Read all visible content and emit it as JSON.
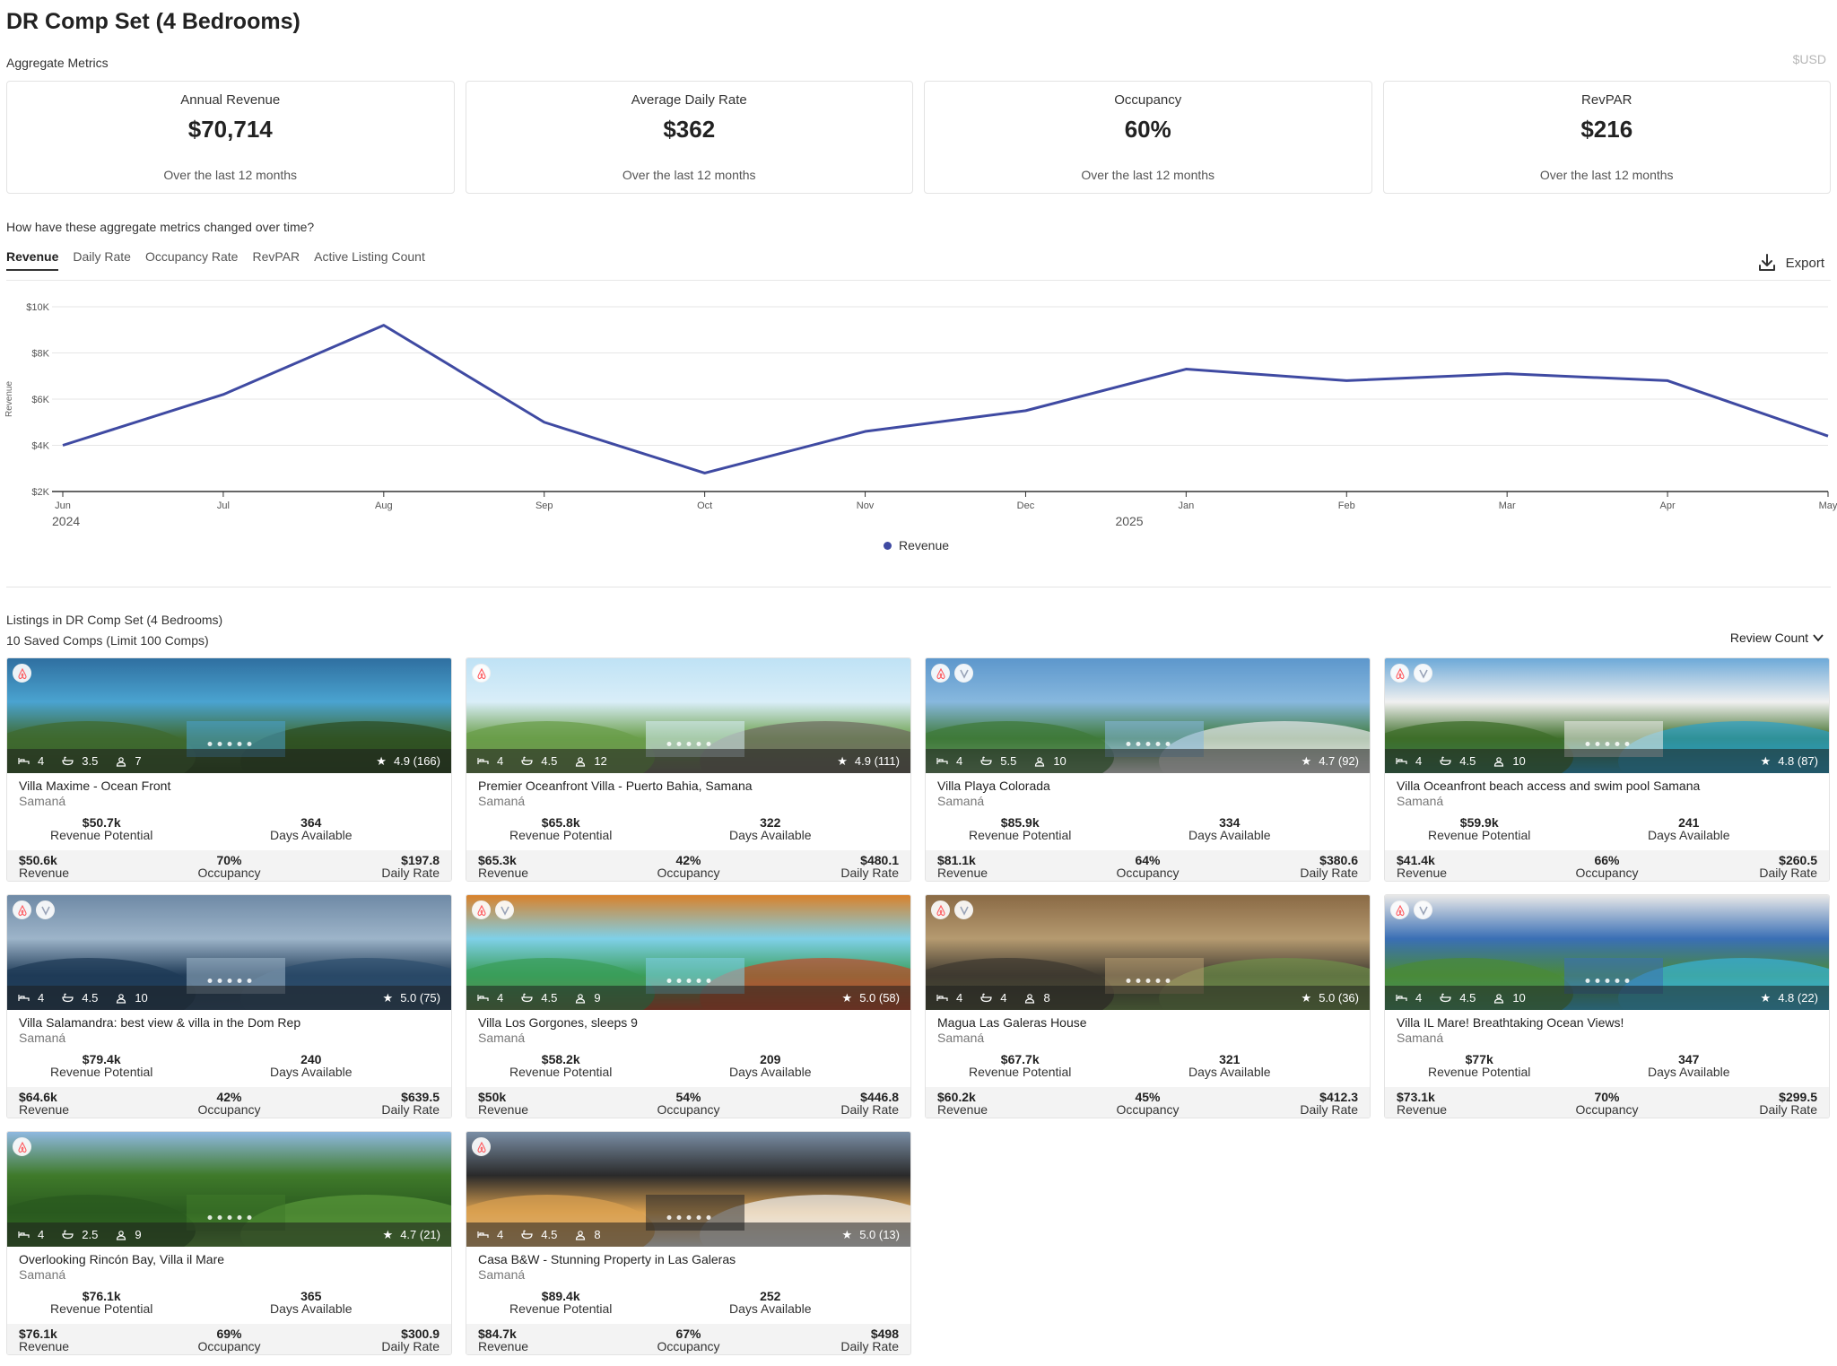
{
  "page": {
    "title": "DR Comp Set (4 Bedrooms)",
    "aggregate_label": "Aggregate Metrics",
    "currency": "$USD"
  },
  "metrics": [
    {
      "title": "Annual Revenue",
      "value": "$70,714",
      "sub": "Over the last 12 months"
    },
    {
      "title": "Average Daily Rate",
      "value": "$362",
      "sub": "Over the last 12 months"
    },
    {
      "title": "Occupancy",
      "value": "60%",
      "sub": "Over the last 12 months"
    },
    {
      "title": "RevPAR",
      "value": "$216",
      "sub": "Over the last 12 months"
    }
  ],
  "change_question": "How have these aggregate metrics changed over time?",
  "tabs": [
    {
      "label": "Revenue",
      "active": true
    },
    {
      "label": "Daily Rate",
      "active": false
    },
    {
      "label": "Occupancy Rate",
      "active": false
    },
    {
      "label": "RevPAR",
      "active": false
    },
    {
      "label": "Active Listing Count",
      "active": false
    }
  ],
  "export_label": "Export",
  "chart_data": {
    "type": "line",
    "x": [
      "Jun",
      "Jul",
      "Aug",
      "Sep",
      "Oct",
      "Nov",
      "Dec",
      "Jan",
      "Feb",
      "Mar",
      "Apr",
      "May"
    ],
    "year_labels": [
      {
        "label": "2024",
        "at": "Jun"
      },
      {
        "label": "2025",
        "at": "Dec"
      }
    ],
    "series": [
      {
        "name": "Revenue",
        "color": "#3f4aa2",
        "values": [
          4000,
          6200,
          9200,
          5000,
          2800,
          4600,
          5500,
          7300,
          6800,
          7100,
          6800,
          4400
        ]
      }
    ],
    "ylabel": "Revenue",
    "yticks": [
      {
        "value": 2000,
        "label": "$2K"
      },
      {
        "value": 4000,
        "label": "$4K"
      },
      {
        "value": 6000,
        "label": "$6K"
      },
      {
        "value": 8000,
        "label": "$8K"
      },
      {
        "value": 10000,
        "label": "$10K"
      }
    ],
    "ylim": [
      2000,
      10000
    ],
    "grid": true,
    "legend": "bottom-center"
  },
  "listings_section": {
    "title": "Listings in DR Comp Set (4 Bedrooms)",
    "subtitle": "10 Saved Comps (Limit 100 Comps)",
    "sort_label": "Review Count"
  },
  "labels": {
    "revenue_potential": "Revenue Potential",
    "days_available": "Days Available",
    "revenue": "Revenue",
    "occupancy": "Occupancy",
    "daily_rate": "Daily Rate"
  },
  "listings": [
    {
      "title": "Villa Maxime - Ocean Front",
      "location": "Samaná",
      "bedrooms": "4",
      "baths": "3.5",
      "guests": "7",
      "rating": "4.9 (166)",
      "revenue_potential": "$50.7k",
      "days_available": "364",
      "revenue": "$50.6k",
      "occupancy": "70%",
      "daily_rate": "$197.8",
      "vrbo": false,
      "palette": [
        "#2f6fa0",
        "#4aa3d0",
        "#3f6a2f",
        "#2b4a1f"
      ]
    },
    {
      "title": "Premier Oceanfront Villa - Puerto Bahia, Samana",
      "location": "Samaná",
      "bedrooms": "4",
      "baths": "4.5",
      "guests": "12",
      "rating": "4.9 (111)",
      "revenue_potential": "$65.8k",
      "days_available": "322",
      "revenue": "$65.3k",
      "occupancy": "42%",
      "daily_rate": "$480.1",
      "vrbo": false,
      "palette": [
        "#bfe2f5",
        "#d9eef8",
        "#6a9e4a",
        "#6e6a60"
      ]
    },
    {
      "title": "Villa Playa Colorada",
      "location": "Samaná",
      "bedrooms": "4",
      "baths": "5.5",
      "guests": "10",
      "rating": "4.7 (92)",
      "revenue_potential": "$85.9k",
      "days_available": "334",
      "revenue": "$81.1k",
      "occupancy": "64%",
      "daily_rate": "$380.6",
      "vrbo": true,
      "palette": [
        "#5d97cc",
        "#87b8de",
        "#3f7a3a",
        "#eaeaea"
      ]
    },
    {
      "title": "Villa Oceanfront beach access and swim pool Samana",
      "location": "Samaná",
      "bedrooms": "4",
      "baths": "4.5",
      "guests": "10",
      "rating": "4.8 (87)",
      "revenue_potential": "$59.9k",
      "days_available": "241",
      "revenue": "$41.4k",
      "occupancy": "66%",
      "daily_rate": "$260.5",
      "vrbo": true,
      "palette": [
        "#6da9d8",
        "#f0f0f0",
        "#3e6e2a",
        "#2aa0c8"
      ]
    },
    {
      "title": "Villa Salamandra: best view & villa in the Dom Rep",
      "location": "Samaná",
      "bedrooms": "4",
      "baths": "4.5",
      "guests": "10",
      "rating": "5.0 (75)",
      "revenue_potential": "$79.4k",
      "days_available": "240",
      "revenue": "$64.6k",
      "occupancy": "42%",
      "daily_rate": "$639.5",
      "vrbo": true,
      "palette": [
        "#6f8aa6",
        "#9db4c9",
        "#1f3b57",
        "#2d4e6e"
      ]
    },
    {
      "title": "Villa Los Gorgones, sleeps 9",
      "location": "Samaná",
      "bedrooms": "4",
      "baths": "4.5",
      "guests": "9",
      "rating": "5.0 (58)",
      "revenue_potential": "$58.2k",
      "days_available": "209",
      "revenue": "$50k",
      "occupancy": "54%",
      "daily_rate": "$446.8",
      "vrbo": true,
      "palette": [
        "#d9822b",
        "#7fd0e8",
        "#3a9e5a",
        "#c04a2a"
      ]
    },
    {
      "title": "Magua Las Galeras House",
      "location": "Samaná",
      "bedrooms": "4",
      "baths": "4",
      "guests": "8",
      "rating": "5.0 (36)",
      "revenue_potential": "$67.7k",
      "days_available": "321",
      "revenue": "$60.2k",
      "occupancy": "45%",
      "daily_rate": "$412.3",
      "vrbo": true,
      "palette": [
        "#8a6a45",
        "#b59a70",
        "#3f3a30",
        "#6f8f4a"
      ]
    },
    {
      "title": "Villa IL Mare! Breathtaking Ocean Views!",
      "location": "Samaná",
      "bedrooms": "4",
      "baths": "4.5",
      "guests": "10",
      "rating": "4.8 (22)",
      "revenue_potential": "$77k",
      "days_available": "347",
      "revenue": "$73.1k",
      "occupancy": "70%",
      "daily_rate": "$299.5",
      "vrbo": true,
      "palette": [
        "#e8e8e8",
        "#3a6fb5",
        "#4a8a3a",
        "#38b3d9"
      ]
    },
    {
      "title": "Overlooking Rincón Bay, Villa il Mare",
      "location": "Samaná",
      "bedrooms": "4",
      "baths": "2.5",
      "guests": "9",
      "rating": "4.7 (21)",
      "revenue_potential": "$76.1k",
      "days_available": "365",
      "revenue": "$76.1k",
      "occupancy": "69%",
      "daily_rate": "$300.9",
      "vrbo": false,
      "palette": [
        "#8fb8e0",
        "#3f7a2a",
        "#2a5a1f",
        "#5a9a3a"
      ]
    },
    {
      "title": "Casa B&W - Stunning Property in Las Galeras",
      "location": "Samaná",
      "bedrooms": "4",
      "baths": "4.5",
      "guests": "8",
      "rating": "5.0 (13)",
      "revenue_potential": "$89.4k",
      "days_available": "252",
      "revenue": "$84.7k",
      "occupancy": "67%",
      "daily_rate": "$498",
      "vrbo": false,
      "palette": [
        "#7a8ea5",
        "#2a2a2a",
        "#d9a050",
        "#f2f2f2"
      ]
    }
  ]
}
